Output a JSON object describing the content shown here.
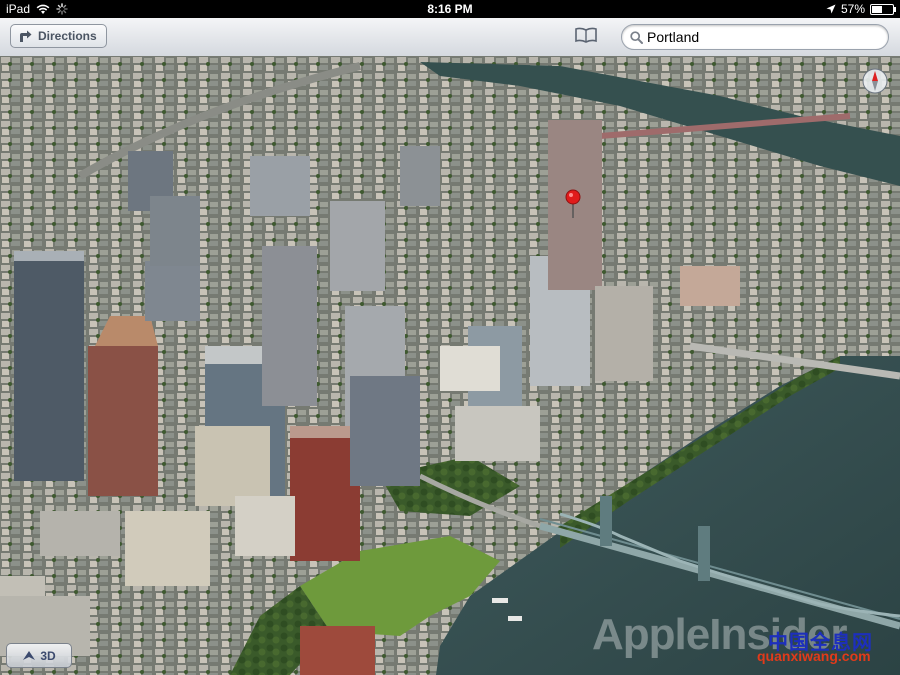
{
  "status_bar": {
    "device": "iPad",
    "time": "8:16 PM",
    "battery_percent": "57%",
    "battery_level": 0.57
  },
  "toolbar": {
    "directions_label": "Directions",
    "bookmarks_icon": "book-icon",
    "search": {
      "value": "Portland",
      "icon": "search-icon"
    }
  },
  "map": {
    "view": "3D flyover",
    "location": "Portland",
    "pin_color": "#e01b1b",
    "compass_icon": "compass-icon",
    "toggle_3d_label": "3D"
  },
  "watermarks": {
    "appleinsider": "AppleInsider",
    "site_cn": "中国全息网",
    "site_url": "quanxiwang.com"
  }
}
